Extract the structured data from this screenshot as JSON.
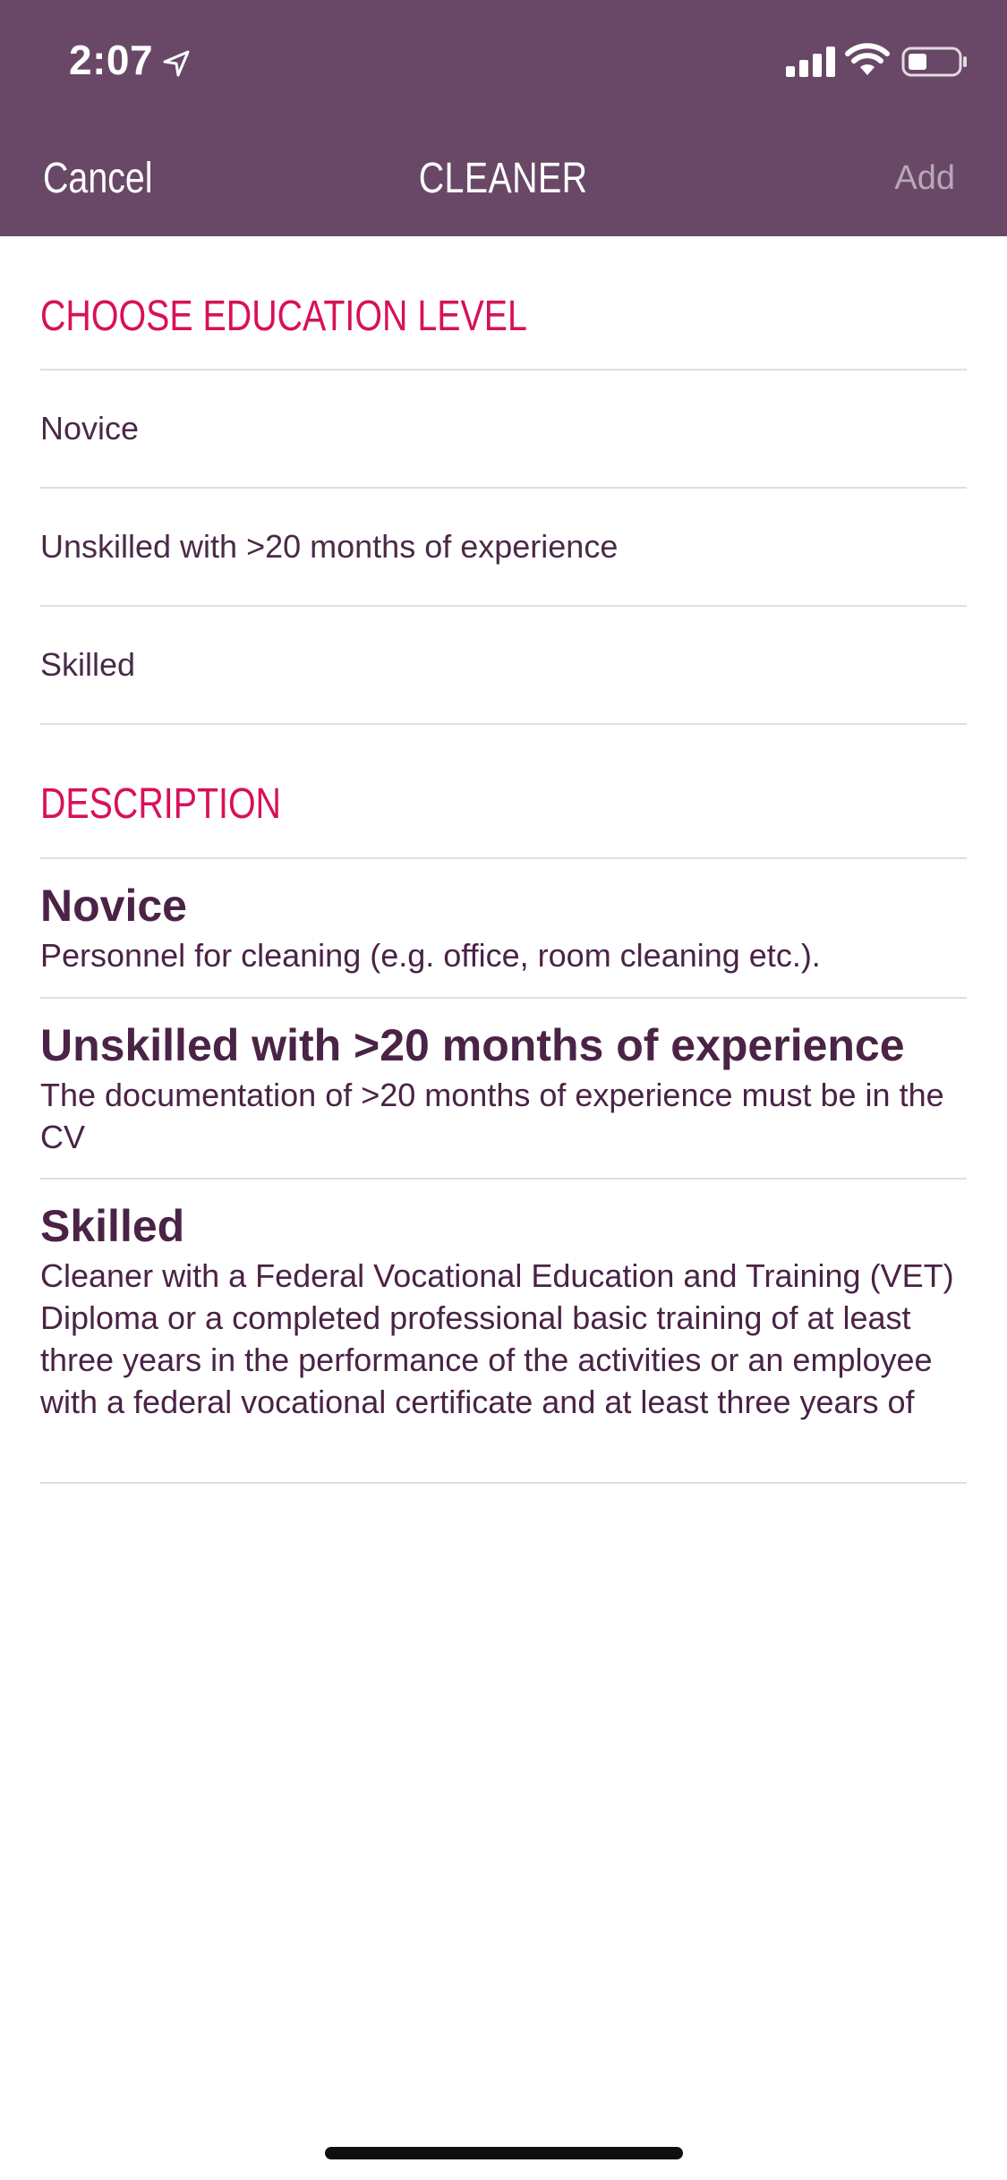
{
  "status_bar": {
    "time": "2:07",
    "location_icon": "location-arrow-icon",
    "signal_icon": "cellular-signal-icon",
    "wifi_icon": "wifi-icon",
    "battery_icon": "battery-icon"
  },
  "nav": {
    "cancel_label": "Cancel",
    "title": "CLEANER",
    "add_label": "Add"
  },
  "education": {
    "title": "CHOOSE EDUCATION LEVEL",
    "options": [
      {
        "label": "Novice"
      },
      {
        "label": "Unskilled with >20 months of experience"
      },
      {
        "label": "Skilled"
      }
    ]
  },
  "description": {
    "title": "DESCRIPTION",
    "items": [
      {
        "title": "Novice",
        "text": "Personnel for cleaning (e.g. office, room cleaning etc.)."
      },
      {
        "title": "Unskilled with >20 months of experience",
        "text": "The documentation of >20 months of experience must be in the CV"
      },
      {
        "title": "Skilled",
        "text": "Cleaner with a Federal Vocational Education and Training (VET) Diploma or a completed professional basic training of at least three years in the performance of the activities or an employee with a federal vocational certificate and at least three years of"
      }
    ]
  },
  "colors": {
    "header_bg": "#694867",
    "accent": "#d8105a",
    "text": "#4a2346",
    "add_disabled": "#b9a6b7"
  }
}
